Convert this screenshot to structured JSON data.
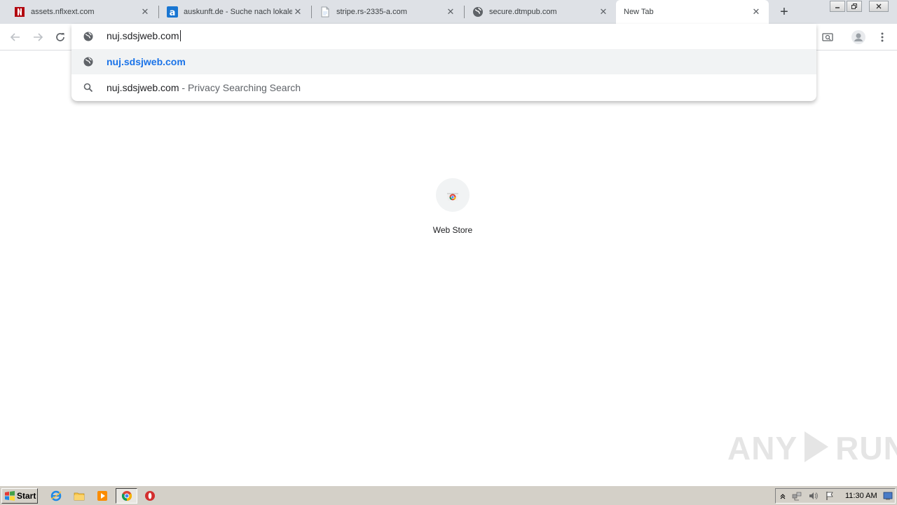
{
  "browser": {
    "tabs": [
      {
        "title": "assets.nflxext.com",
        "favicon": "netflix-icon"
      },
      {
        "title": "auskunft.de - Suche nach lokalen",
        "favicon": "auskunft-icon"
      },
      {
        "title": "stripe.rs-2335-a.com",
        "favicon": "page-icon"
      },
      {
        "title": "secure.dtmpub.com",
        "favicon": "globe-icon"
      },
      {
        "title": "New Tab",
        "favicon": ""
      }
    ],
    "active_tab": 4,
    "close_glyph": "✕",
    "newtab_glyph": "+"
  },
  "omnibox": {
    "input_value": "nuj.sdsjweb.com",
    "suggestions": [
      {
        "main": "nuj.sdsjweb.com",
        "desc": "",
        "icon": "globe-icon",
        "selected": true
      },
      {
        "main": "nuj.sdsjweb.com",
        "desc": " - Privacy Searching Search",
        "icon": "search-icon",
        "selected": false
      }
    ]
  },
  "ntp": {
    "shortcuts": [
      {
        "label": "Web Store",
        "icon": "chrome-web-store-icon"
      }
    ]
  },
  "watermark": {
    "left": "ANY",
    "right": "RUN"
  },
  "taskbar": {
    "start_label": "Start",
    "clock": "11:30 AM"
  },
  "colors": {
    "tabstrip": "#dee1e6",
    "accent_blue": "#1a73e8",
    "taskbar": "#d4d0c8"
  }
}
